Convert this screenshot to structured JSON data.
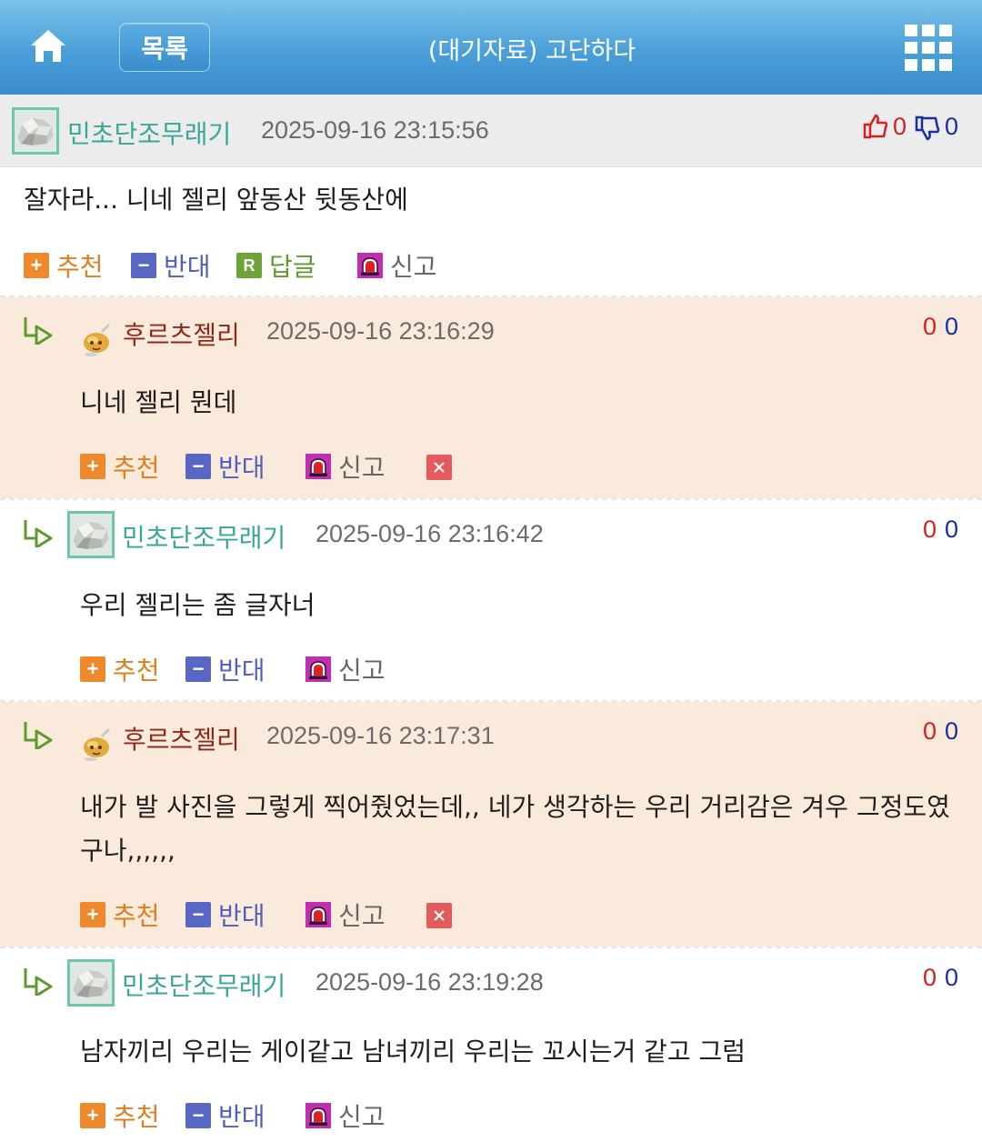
{
  "header": {
    "list_label": "목록",
    "title": "(대기자료) 고단하다"
  },
  "post": {
    "author": "민초단조무래기",
    "datetime": "2025-09-16 23:15:56",
    "up": "0",
    "down": "0",
    "content": "잘자라... 니네 젤리 앞동산 뒷동산에",
    "actions": {
      "recommend": "추천",
      "oppose": "반대",
      "reply": "답글",
      "report": "신고"
    }
  },
  "comments": [
    {
      "author": "후르츠젤리",
      "datetime": "2025-09-16 23:16:29",
      "up": "0",
      "down": "0",
      "content": "니네 젤리 뭔데",
      "recommend": "추천",
      "oppose": "반대",
      "report": "신고"
    },
    {
      "author": "민초단조무래기",
      "datetime": "2025-09-16 23:16:42",
      "up": "0",
      "down": "0",
      "content": "우리 젤리는 좀 글자너",
      "recommend": "추천",
      "oppose": "반대",
      "report": "신고"
    },
    {
      "author": "후르츠젤리",
      "datetime": "2025-09-16 23:17:31",
      "up": "0",
      "down": "0",
      "content": "내가 발 사진을 그렇게 찍어줬었는데,, 네가 생각하는 우리 거리감은 겨우 그정도였구나,,,,,,",
      "recommend": "추천",
      "oppose": "반대",
      "report": "신고"
    },
    {
      "author": "민초단조무래기",
      "datetime": "2025-09-16 23:19:28",
      "up": "0",
      "down": "0",
      "content": "남자끼리 우리는 게이같고 남녀끼리 우리는 꼬시는거 같고 그럼",
      "recommend": "추천",
      "oppose": "반대",
      "report": "신고"
    }
  ],
  "colors": {
    "header_blue": "#4a9fd8",
    "comment_peach": "#faeadb",
    "nick_teal": "#3aa69a",
    "nick_brown": "#8e2a1c",
    "up_red": "#d42020",
    "down_navy": "#1b2ea0"
  },
  "icons": [
    "home-icon",
    "grid-menu-icon",
    "thumbs-up-icon",
    "thumbs-down-icon",
    "plus-icon",
    "minus-icon",
    "reply-icon",
    "siren-icon",
    "close-icon",
    "reply-arrow-icon"
  ]
}
